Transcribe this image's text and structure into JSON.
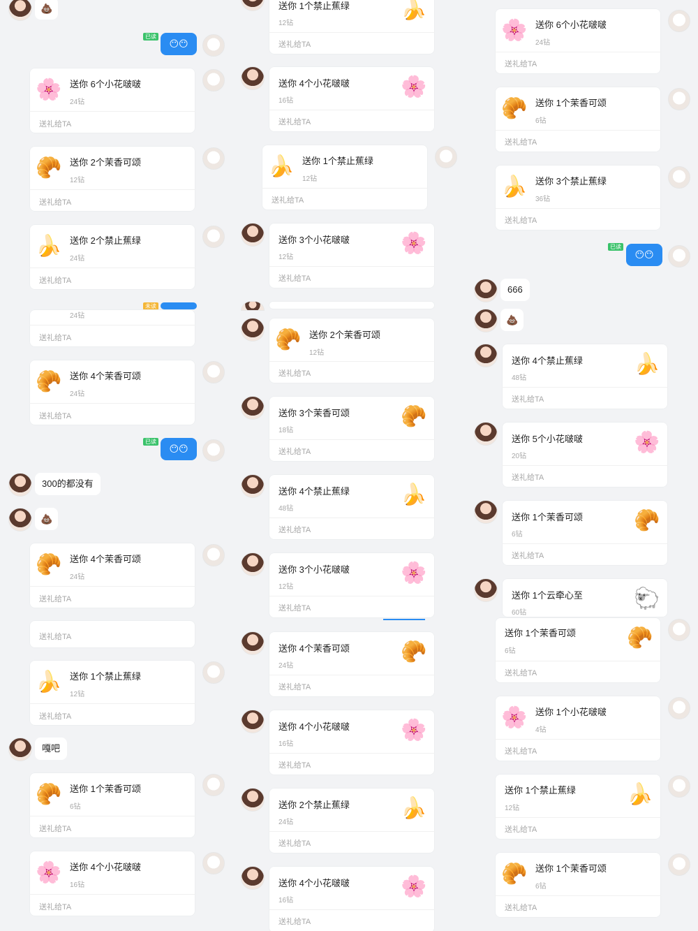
{
  "common": {
    "foot": "送礼给TA",
    "read": "已读",
    "unread": "未读",
    "face_emoji": "😶😶"
  },
  "msg": {
    "c1_text_300": "300的都没有",
    "c1_text_gaba": "嘎吧",
    "c3_text_666": "666"
  },
  "gifts": {
    "g_6_flower": "送你 6个小花啵啵",
    "g_1_banana": "送你 1个禁止蕉绿",
    "g_2_banana": "送你 2个禁止蕉绿",
    "g_3_banana": "送你 3个禁止蕉绿",
    "g_4_banana": "送你 4个禁止蕉绿",
    "g_1_bouquet": "送你 1个茉香可颂",
    "g_2_bouquet": "送你 2个茉香可颂",
    "g_3_bouquet": "送你 3个茉香可颂",
    "g_4_bouquet": "送你 4个茉香可颂",
    "g_1_flower": "送你 1个小花啵啵",
    "g_3_flower": "送你 3个小花啵啵",
    "g_4_flower": "送你 4个小花啵啵",
    "g_5_flower": "送你 5个小花啵啵",
    "g_1_sheep": "送你 1个云牵心至"
  },
  "prices": {
    "p4": "4钻",
    "p6": "6钻",
    "p12": "12钻",
    "p16": "16钻",
    "p18": "18钻",
    "p20": "20钻",
    "p24": "24钻",
    "p36": "36钻",
    "p48": "48钻",
    "p60": "60钻"
  }
}
